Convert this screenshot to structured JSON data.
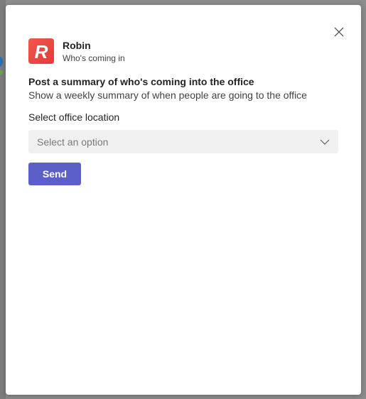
{
  "app": {
    "name": "Robin",
    "subtitle": "Who's coming in",
    "logo_letter": "R",
    "logo_color": "#e9443f"
  },
  "card": {
    "title": "Post a summary of who's coming into the office",
    "description": "Show a weekly summary of when people are going to the office"
  },
  "form": {
    "location_label": "Select office location",
    "location_placeholder": "Select an option",
    "send_label": "Send"
  },
  "icons": {
    "close": "close-icon",
    "dropdown": "chevron-down-icon"
  },
  "colors": {
    "accent": "#5b5fc7",
    "select_bg": "#f0f0f0"
  }
}
